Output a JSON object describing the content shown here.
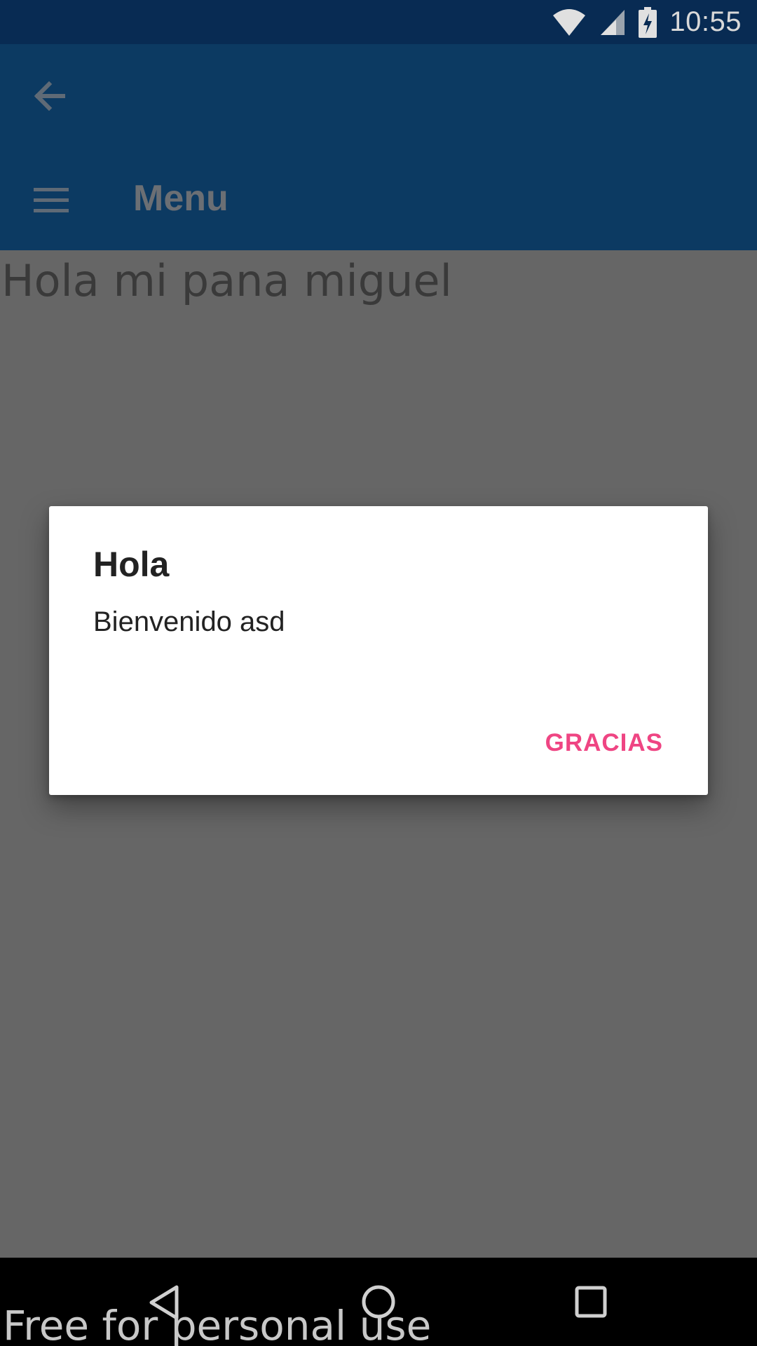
{
  "status_bar": {
    "time": "10:55",
    "icons": [
      "wifi-icon",
      "signal-icon",
      "battery-charging-icon"
    ]
  },
  "app_bar": {
    "back_icon": "arrow-back-icon",
    "menu_icon": "hamburger-icon",
    "title": "Menu"
  },
  "content": {
    "greeting": "Hola mi pana miguel"
  },
  "dialog": {
    "title": "Hola",
    "message": "Bienvenido asd",
    "button_label": "GRACIAS",
    "button_color": "#ef4583"
  },
  "nav_bar": {
    "icons": [
      "nav-back-icon",
      "nav-home-icon",
      "nav-recents-icon"
    ]
  },
  "watermark": "Free for personal use",
  "colors": {
    "status_bar": "#082b53",
    "app_bar": "#0c3a62",
    "scrim_background": "#666666"
  }
}
